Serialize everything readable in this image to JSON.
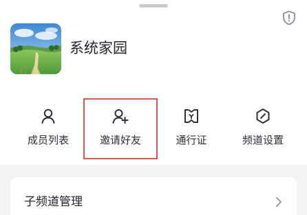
{
  "server": {
    "name": "系统家园"
  },
  "actions": [
    {
      "label": "成员列表",
      "icon": "member-list-icon"
    },
    {
      "label": "邀请好友",
      "icon": "invite-friend-icon"
    },
    {
      "label": "通行证",
      "icon": "pass-icon"
    },
    {
      "label": "频道设置",
      "icon": "channel-settings-icon"
    }
  ],
  "settings": {
    "subchannel_label": "子频道管理"
  },
  "colors": {
    "highlight_border": "#d9534f",
    "text_primary": "#1f2329",
    "panel_background": "#f2f3f5"
  }
}
